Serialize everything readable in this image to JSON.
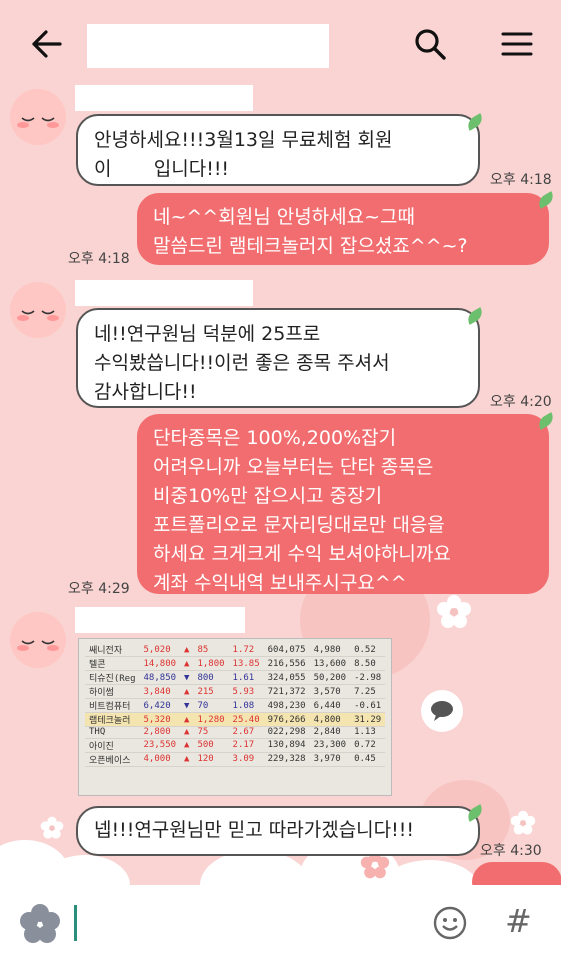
{
  "header": {
    "back_icon": "arrow-left-icon",
    "search_icon": "search-icon",
    "menu_icon": "hamburger-menu-icon"
  },
  "messages": [
    {
      "from": "other",
      "text": "안녕하세요!!!3월13일 무료체험 회원\n이       입니다!!!",
      "time": "오후 4:18"
    },
    {
      "from": "me",
      "text": "네~^^회원님 안녕하세요~그때\n말씀드린 램테크놀러지 잡으셨죠^^~?",
      "time": "오후 4:18"
    },
    {
      "from": "other",
      "text": "네!!연구원님 덕분에 25프로\n수익봤씁니다!!이런 좋은 종목 주셔서\n감사합니다!!",
      "time": "오후 4:20"
    },
    {
      "from": "me",
      "text": "단타종목은 100%,200%잡기\n어려우니까 오늘부터는 단타 종목은\n비중10%만 잡으시고 중장기\n포트폴리오로 문자리딩대로만 대응을\n하세요 크게크게 수익 보셔야하니까요\n계좌 수익내역 보내주시구요^^",
      "time": "오후 4:29"
    },
    {
      "from": "other",
      "text": "넵!!!연구원님만 믿고 따라가겠습니다!!!",
      "time": "오후 4:30"
    }
  ],
  "photo_rows": [
    [
      "쌔니전자",
      "5,020",
      "▲",
      "85",
      "1.72",
      "604,075",
      "4,980",
      "0.52"
    ],
    [
      "텔콘",
      "14,800",
      "▲",
      "1,800",
      "13.85",
      "216,556",
      "13,600",
      "8.50"
    ],
    [
      "티슈진(Reg",
      "48,850",
      "▼",
      "800",
      "1.61",
      "324,055",
      "50,200",
      "-2.98"
    ],
    [
      "하이썸",
      "3,840",
      "▲",
      "215",
      "5.93",
      "721,372",
      "3,570",
      "7.25"
    ],
    [
      "비트컴퓨터",
      "6,420",
      "▼",
      "70",
      "1.08",
      "498,230",
      "6,440",
      "-0.61"
    ],
    [
      "램테크놀러",
      "5,320",
      "▲",
      "1,280",
      "25.40",
      "976,266",
      "4,800",
      "31.29"
    ],
    [
      "THQ",
      "2,800",
      "▲",
      "75",
      "2.67",
      "022,298",
      "2,840",
      "1.13"
    ],
    [
      "아이진",
      "23,550",
      "▲",
      "500",
      "2.17",
      "130,894",
      "23,300",
      "0.72"
    ],
    [
      "오픈베이스",
      "4,000",
      "▲",
      "120",
      "3.09",
      "229,328",
      "3,970",
      "0.45"
    ]
  ],
  "input_bar": {
    "emoticon_icon": "flower-emoticon-icon",
    "smile_icon": "smiley-icon",
    "hash_label": "#"
  },
  "colors": {
    "background": "#f9d4d2",
    "outgoing_bubble": "#f26d6f",
    "incoming_bubble": "#ffffff"
  }
}
